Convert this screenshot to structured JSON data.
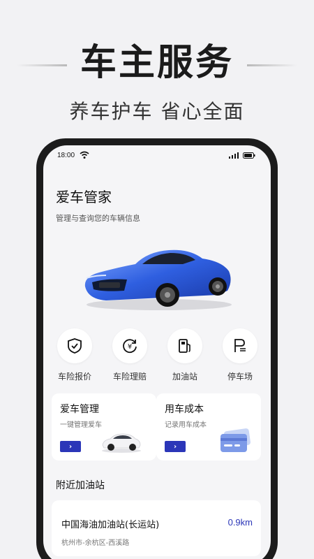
{
  "hero": {
    "title": "车主服务",
    "subtitle": "养车护车  省心全面"
  },
  "status_bar": {
    "time": "18:00",
    "icons": [
      "wifi-icon",
      "signal-icon",
      "battery-icon"
    ]
  },
  "app": {
    "title": "爱车管家",
    "subtitle": "管理与查询您的车辆信息"
  },
  "services": [
    {
      "label": "车险报价",
      "icon": "shield-check-icon"
    },
    {
      "label": "车险理赔",
      "icon": "yen-refresh-icon"
    },
    {
      "label": "加油站",
      "icon": "fuel-pump-icon"
    },
    {
      "label": "停车场",
      "icon": "parking-icon"
    }
  ],
  "cards": [
    {
      "title": "爱车管理",
      "subtitle": "一键管理爱车",
      "icon": "white-car-icon"
    },
    {
      "title": "用车成本",
      "subtitle": "记录用车成本",
      "icon": "wallet-card-icon"
    }
  ],
  "nearby": {
    "title": "附近加油站",
    "stations": [
      {
        "name": "中国海油加油站(长运站)",
        "distance": "0.9km",
        "address": "杭州市-余杭区-西溪路"
      }
    ]
  },
  "colors": {
    "accent": "#2b36b8",
    "background": "#f5f5f7",
    "phone_frame": "#1c1c1c"
  }
}
